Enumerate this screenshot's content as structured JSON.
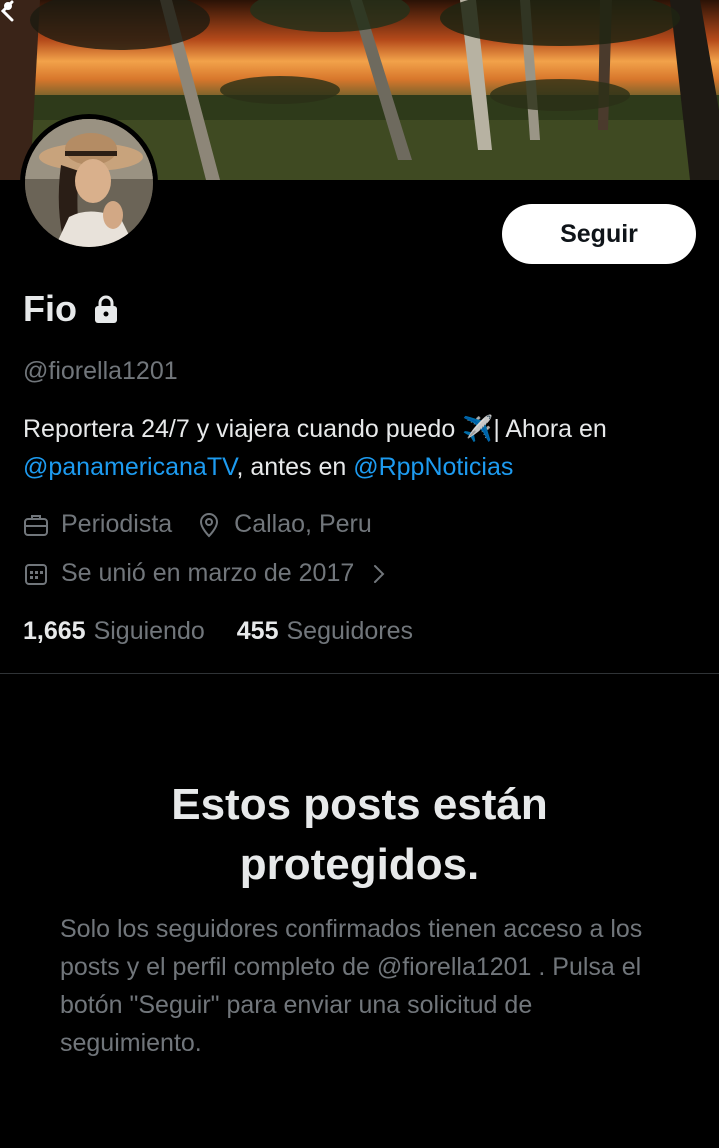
{
  "profile": {
    "name": "Fio",
    "handle": "@fiorella1201",
    "bio_part1": "Reportera 24/7 y viajera cuando puedo ✈️| Ahora en ",
    "bio_link1": "@panamericanaTV",
    "bio_part2": ", antes en ",
    "bio_link2": "@RppNoticias",
    "occupation": "Periodista",
    "location": "Callao, Peru",
    "joined": "Se unió en marzo de 2017",
    "following_count": "1,665",
    "following_label": "Siguiendo",
    "followers_count": "455",
    "followers_label": "Seguidores"
  },
  "actions": {
    "follow_label": "Seguir"
  },
  "protected": {
    "title": "Estos posts están protegidos.",
    "message": "Solo los seguidores confirmados tienen acceso a los posts y el perfil completo de @fiorella1201 . Pulsa el botón \"Seguir\" para enviar una solicitud de seguimiento."
  },
  "icons": {
    "back": "back-arrow-icon",
    "more": "more-options-icon",
    "lock": "lock-icon",
    "briefcase": "briefcase-icon",
    "location": "location-pin-icon",
    "calendar": "calendar-icon",
    "chevron": "chevron-right-icon"
  },
  "colors": {
    "background": "#000000",
    "text_primary": "#e7e9ea",
    "text_secondary": "#71767b",
    "link": "#1d9bf0",
    "button_bg": "#ffffff"
  }
}
